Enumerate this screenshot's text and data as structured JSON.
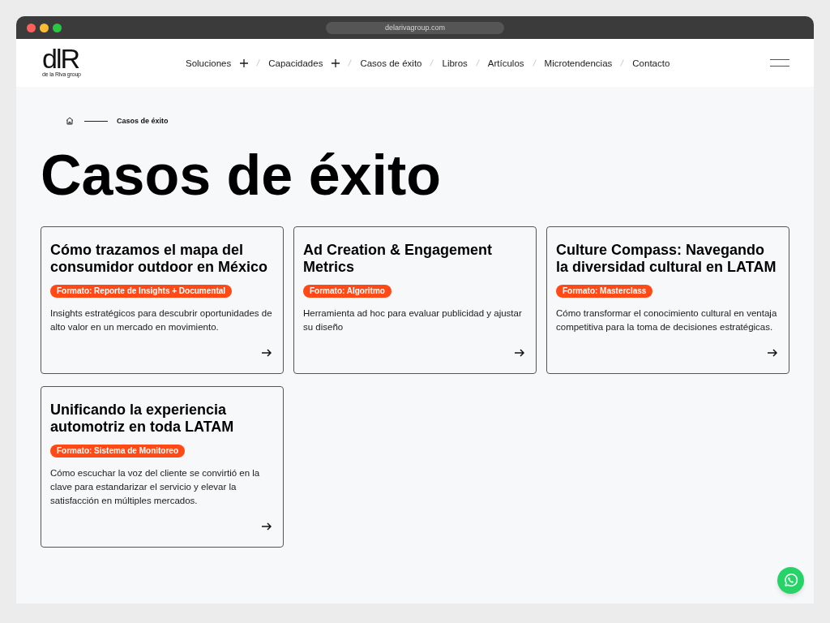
{
  "browser": {
    "url": "delarivagroup.com"
  },
  "header": {
    "logo": {
      "mark": "dlR",
      "tagline": "de la Riva group"
    },
    "nav": [
      {
        "label": "Soluciones",
        "expandable": true
      },
      {
        "label": "Capacidades",
        "expandable": true
      },
      {
        "label": "Casos de éxito",
        "expandable": false
      },
      {
        "label": "Libros",
        "expandable": false
      },
      {
        "label": "Artículos",
        "expandable": false
      },
      {
        "label": "Microtendencias",
        "expandable": false
      },
      {
        "label": "Contacto",
        "expandable": false
      }
    ]
  },
  "breadcrumb": {
    "current": "Casos de éxito"
  },
  "page_title": "Casos de éxito",
  "cards": [
    {
      "title": "Cómo trazamos el mapa del consumidor outdoor en México",
      "format": "Formato: Reporte de Insights + Documental",
      "description": "Insights estratégicos para descubrir oportunidades de alto valor en un mercado en movimiento."
    },
    {
      "title": "Ad Creation & Engagement Metrics",
      "format": "Formato: Algoritmo",
      "description": "Herramienta ad hoc para evaluar publicidad y ajustar su diseño"
    },
    {
      "title": "Culture Compass: Navegando la diversidad cultural en LATAM",
      "format": "Formato: Masterclass",
      "description": "Cómo transformar el conocimiento cultural en ventaja competitiva para la toma de decisiones estratégicas."
    },
    {
      "title": "Unificando la experiencia automotriz en toda LATAM",
      "format": "Formato: Sistema de Monitoreo",
      "description": "Cómo escuchar la voz del cliente se convirtió en la clave para estandarizar el servicio y elevar la satisfacción en múltiples mercados."
    }
  ]
}
